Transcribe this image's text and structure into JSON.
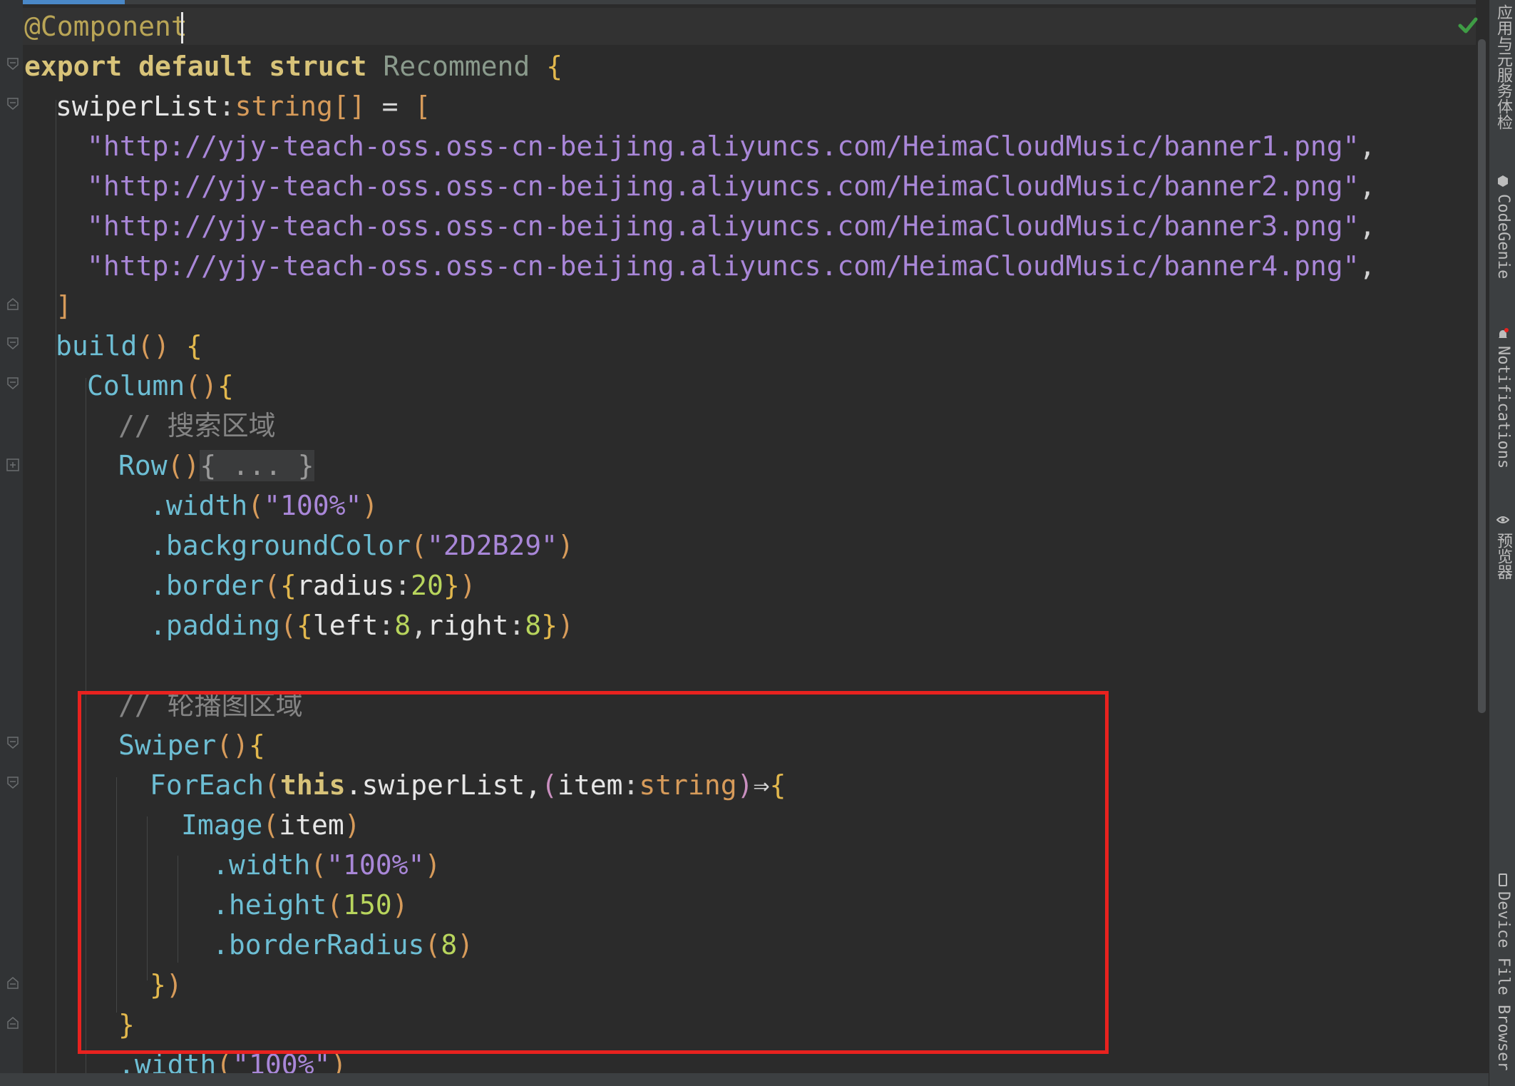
{
  "editor": {
    "line1": {
      "decorator": "@Component"
    },
    "line2": {
      "kw1": "export",
      "kw2": "default",
      "kw3": "struct",
      "class_name": "Recommend",
      "brace": "{"
    },
    "line3": {
      "name": "swiperList",
      "colon": ":",
      "type": "string[]",
      "assign": " = ",
      "bracket": "["
    },
    "urls": [
      "\"http://yjy-teach-oss.oss-cn-beijing.aliyuncs.com/HeimaCloudMusic/banner1.png\"",
      "\"http://yjy-teach-oss.oss-cn-beijing.aliyuncs.com/HeimaCloudMusic/banner2.png\"",
      "\"http://yjy-teach-oss.oss-cn-beijing.aliyuncs.com/HeimaCloudMusic/banner3.png\"",
      "\"http://yjy-teach-oss.oss-cn-beijing.aliyuncs.com/HeimaCloudMusic/banner4.png\""
    ],
    "url_suffix": ",",
    "array_close": "]",
    "build": {
      "name": "build",
      "parens": "()",
      "brace": "{"
    },
    "column": {
      "name": "Column",
      "parens": "()",
      "brace": "{"
    },
    "comment_search": "// 搜索区域",
    "row": {
      "name": "Row",
      "parens": "()",
      "folded": "{ ... }"
    },
    "row_width": {
      "name": ".width",
      "open": "(",
      "arg": "\"100%\"",
      "close": ")"
    },
    "row_bg": {
      "name": ".backgroundColor",
      "open": "(",
      "arg": "\"2D2B29\"",
      "close": ")"
    },
    "row_border": {
      "name": ".border",
      "open": "(",
      "brace_open": "{",
      "key": "radius",
      "colon": ":",
      "value": "20",
      "brace_close": "}",
      "close": ")"
    },
    "row_padding": {
      "name": ".padding",
      "open": "(",
      "brace_open": "{",
      "key1": "left",
      "colon1": ":",
      "value1": "8",
      "comma": ",",
      "key2": "right",
      "colon2": ":",
      "value2": "8",
      "brace_close": "}",
      "close": ")"
    },
    "comment_swiper": "// 轮播图区域",
    "swiper": {
      "name": "Swiper",
      "parens": "()",
      "brace": "{"
    },
    "foreach": {
      "name": "ForEach",
      "open": "(",
      "this": "this",
      "prop": ".swiperList,",
      "lparen": "(",
      "param": "item",
      "colon": ":",
      "type": "string",
      "rparen": ")",
      "arrow": "⇒",
      "brace": "{"
    },
    "image": {
      "name": "Image",
      "open": "(",
      "arg": "item",
      "close": ")"
    },
    "img_width": {
      "name": ".width",
      "open": "(",
      "arg": "\"100%\"",
      "close": ")"
    },
    "img_height": {
      "name": ".height",
      "open": "(",
      "arg": "150",
      "close": ")"
    },
    "img_radius": {
      "name": ".borderRadius",
      "open": "(",
      "arg": "8",
      "close": ")"
    },
    "foreach_close": {
      "brace": "}",
      "paren": ")"
    },
    "swiper_close": "}",
    "swiper_width": {
      "name": ".width",
      "open": "(",
      "arg": "\"100%\"",
      "close": ")"
    }
  },
  "right_panel": {
    "items": [
      "应用与元服务体检",
      "CodeGenie",
      "Notifications",
      "预览器",
      "Device File Browser"
    ]
  },
  "colors": {
    "background": "#2b2b2b",
    "highlight_border": "#e8221f",
    "inspection_ok": "#3f9c45"
  }
}
